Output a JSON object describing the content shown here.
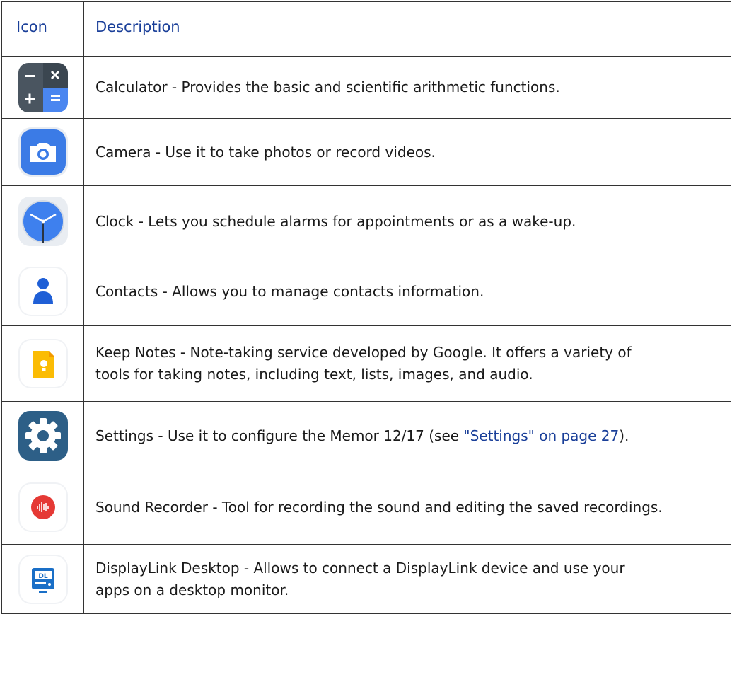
{
  "table": {
    "headers": {
      "icon": "Icon",
      "description": "Description"
    },
    "rows": [
      {
        "icon": "calculator-icon",
        "text": "Calculator - Provides the basic and scientific arithmetic functions."
      },
      {
        "icon": "camera-icon",
        "text": "Camera - Use it to take photos or record videos."
      },
      {
        "icon": "clock-icon",
        "text": "Clock - Lets you schedule alarms for appointments or as a wake-up."
      },
      {
        "icon": "contacts-icon",
        "text": "Contacts - Allows you to manage contacts information."
      },
      {
        "icon": "keep-notes-icon",
        "text_line1": "Keep Notes - Note-taking service developed by Google. It offers a variety of",
        "text_line2": "tools for taking notes, including text, lists, images, and audio."
      },
      {
        "icon": "settings-icon",
        "text_before": "Settings - Use it to configure the Memor 12/17 (see ",
        "link": "\"Settings\" on page 27",
        "text_after": ")."
      },
      {
        "icon": "sound-recorder-icon",
        "text": "Sound Recorder - Tool for recording the sound and editing the saved recordings."
      },
      {
        "icon": "displaylink-desktop-icon",
        "text_line1": "DisplayLink Desktop - Allows to connect a DisplayLink device and use your",
        "text_line2": "apps on a desktop monitor.",
        "icon_label": "DL"
      }
    ]
  },
  "colors": {
    "header_text": "#1a3f99",
    "link": "#1a3f99",
    "border": "#333333"
  }
}
